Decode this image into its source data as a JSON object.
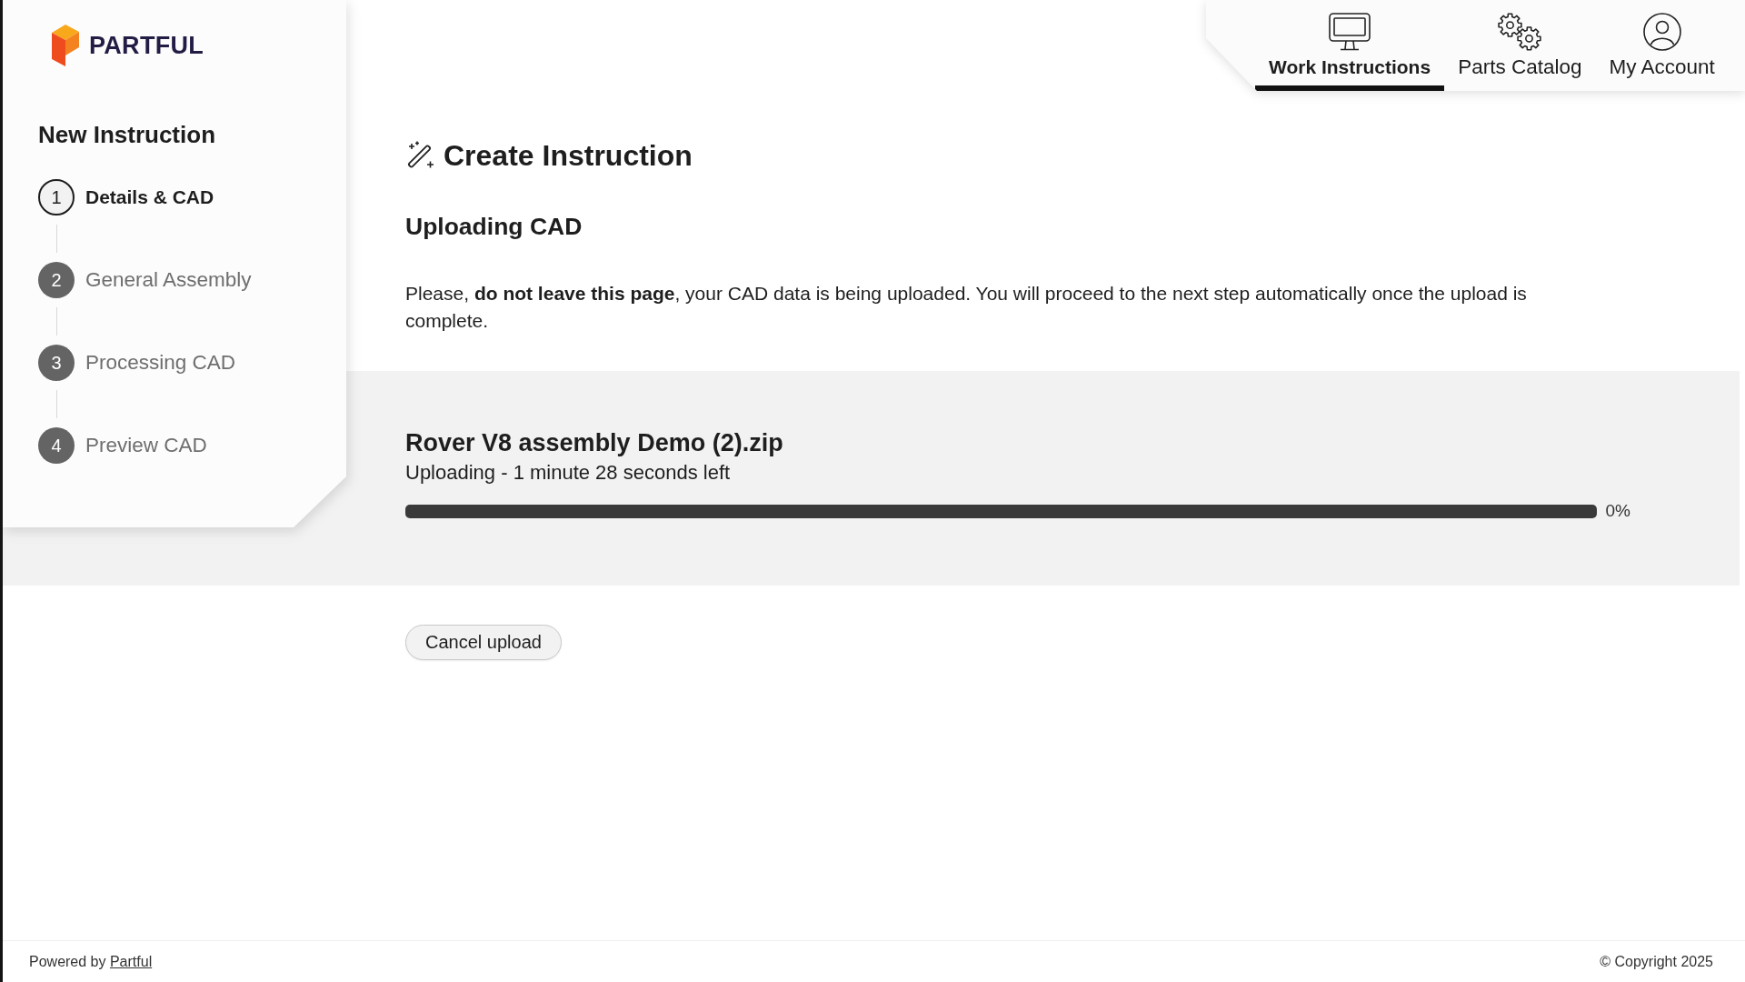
{
  "brand": {
    "name": "PARTFUL"
  },
  "nav": {
    "tabs": [
      {
        "kind": "instructions",
        "label": "Work Instructions",
        "selected": true
      },
      {
        "kind": "catalog",
        "label": "Parts Catalog",
        "selected": false
      },
      {
        "kind": "account",
        "label": "My Account",
        "selected": false
      }
    ]
  },
  "sidebar": {
    "title": "New Instruction",
    "steps": [
      {
        "number": "1",
        "label": "Details & CAD",
        "selected": true
      },
      {
        "number": "2",
        "label": "General Assembly",
        "selected": false
      },
      {
        "number": "3",
        "label": "Processing CAD",
        "selected": false
      },
      {
        "number": "4",
        "label": "Preview CAD",
        "selected": false
      }
    ]
  },
  "main": {
    "title": "Create Instruction",
    "subtitle": "Uploading CAD",
    "message": "Please, **do not leave this page**, your CAD data is being uploaded. You will proceed to the next step automatically once the upload is complete."
  },
  "upload": {
    "file_name": "Rover V8 assembly Demo (2).zip",
    "status": "Uploading - 1 minute 28 seconds left",
    "level": 0,
    "percent": "0%"
  },
  "actions": {
    "cancel": "Cancel upload"
  },
  "footer": {
    "powered_by": "Powered by",
    "link": "Partful",
    "copyright": "© Copyright 2025"
  }
}
